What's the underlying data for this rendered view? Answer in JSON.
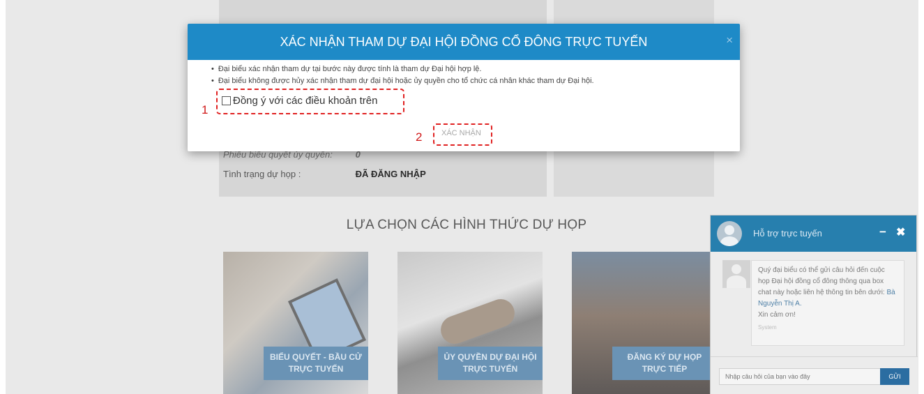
{
  "background": {
    "info_rows": [
      {
        "label": "Phiếu biểu quyết ủy quyền:",
        "value": "0",
        "italic": true
      },
      {
        "label": "Tình trạng dự họp :",
        "value": "ĐÃ ĐĂNG NHẬP",
        "italic": false
      }
    ],
    "section_title": "LỰA CHỌN CÁC HÌNH THỨC DỰ HỌP",
    "options": [
      {
        "label": "BIỂU QUYẾT - BẦU CỬ TRỰC TUYẾN"
      },
      {
        "label": "ỦY QUYỀN DỰ ĐẠI HỘI TRỰC TUYẾN"
      },
      {
        "label": "ĐĂNG KÝ DỰ HỌP TRỰC TIẾP"
      }
    ]
  },
  "modal": {
    "title": "XÁC NHẬN THAM DỰ ĐẠI HỘI ĐỒNG CỔ ĐÔNG TRỰC TUYẾN",
    "close": "×",
    "bullets": [
      "Đại biểu xác nhận tham dự tại bước này được tính là tham dự Đại hội hợp lệ.",
      "Đại biểu không được hủy xác nhận tham dự đại hội hoặc ủy quyền cho tổ chức cá nhân khác tham dự Đại hội."
    ],
    "agree_label": "Đồng ý với các điều khoản trên",
    "agree_checked": false,
    "confirm_label": "XÁC NHẬN",
    "annotation_1": "1",
    "annotation_2": "2",
    "annotation_color": "#e02020"
  },
  "chat": {
    "title": "Hỗ trợ trực tuyến",
    "minimize": "−",
    "close": "✖",
    "message_line1": "Quý đại biểu có thể gửi câu hỏi đến cuộc họp Đại hội đồng cổ đông thông qua box chat này hoặc liên hệ thông tin bên dưới: ",
    "message_name": "Bà Nguyễn Thị A.",
    "message_thanks": "Xin cảm ơn!",
    "message_sender": "System",
    "input_placeholder": "Nhập câu hỏi của bạn vào đây",
    "send_label": "GỬI",
    "header_color": "#277fae"
  },
  "colors": {
    "modal_header": "#1e8ac7",
    "option_label_bg": "#6a93b5"
  }
}
